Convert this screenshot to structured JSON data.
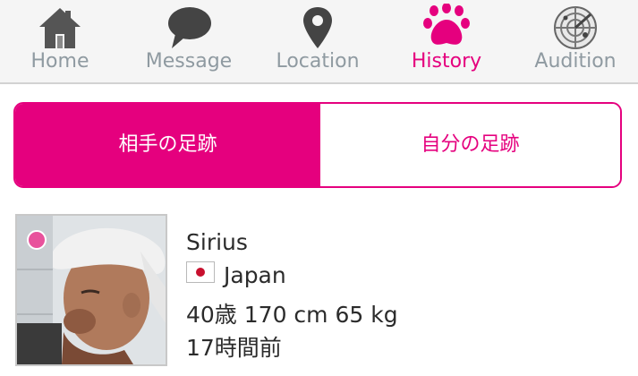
{
  "nav": {
    "items": [
      {
        "label": "Home",
        "icon": "home-icon",
        "active": false
      },
      {
        "label": "Message",
        "icon": "speech-bubble-icon",
        "active": false
      },
      {
        "label": "Location",
        "icon": "map-pin-icon",
        "active": false
      },
      {
        "label": "History",
        "icon": "paw-icon",
        "active": true
      },
      {
        "label": "Audition",
        "icon": "radar-icon",
        "active": false
      }
    ],
    "accent_color": "#e5007e",
    "inactive_color": "#8f9aa1"
  },
  "segment": {
    "left_label": "相手の足跡",
    "right_label": "自分の足跡",
    "selected": "left"
  },
  "profile": {
    "name": "Sirius",
    "country": "Japan",
    "flag_icon": "japan-flag-icon",
    "stats": "40歳 170 cm 65 kg",
    "time_ago": "17時間前",
    "online_dot_color": "#e8529c"
  }
}
